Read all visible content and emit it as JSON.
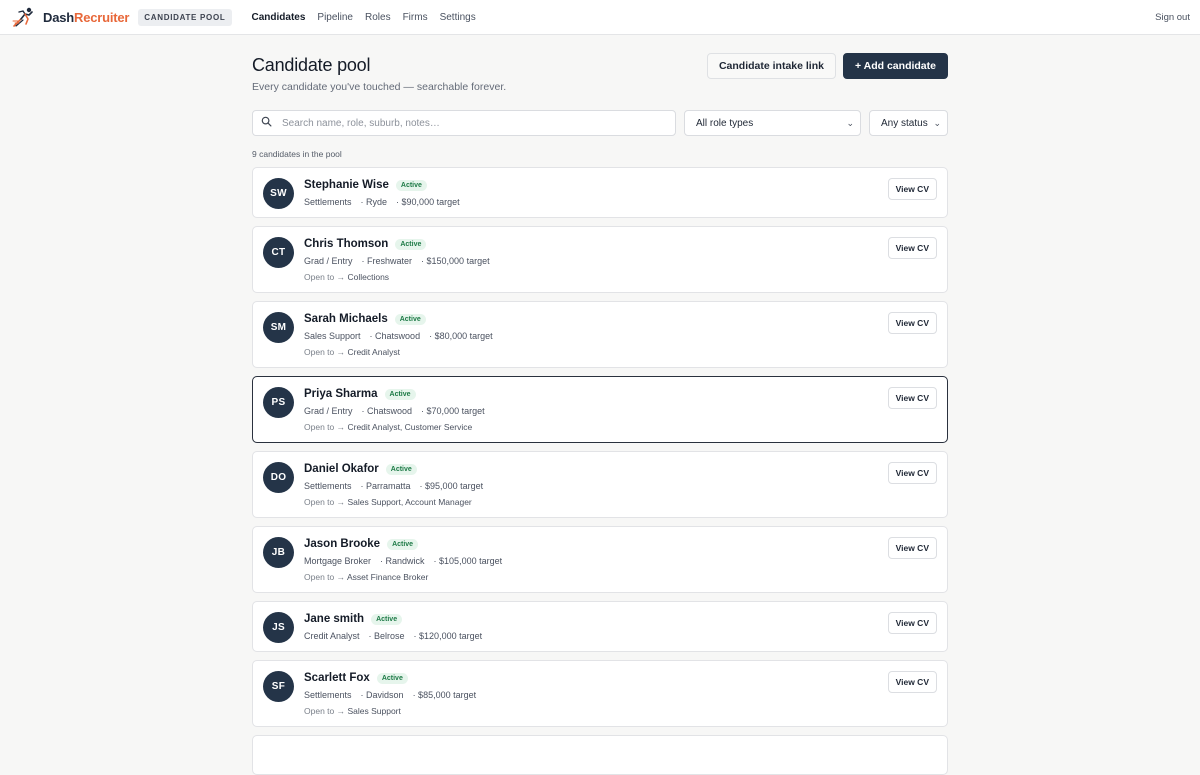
{
  "colors": {
    "brand_dark": "#1f2a3c",
    "brand_accent": "#e8683a",
    "primary_button": "#243448",
    "avatar_bg": "#243448",
    "status_active_bg": "#e6f5ec",
    "status_active_text": "#1d7a46"
  },
  "header": {
    "brand_part1": "Dash",
    "brand_part2": "Recruiter",
    "section_tag": "CANDIDATE POOL",
    "nav": [
      "Candidates",
      "Pipeline",
      "Roles",
      "Firms",
      "Settings"
    ],
    "active_nav": "Candidates",
    "signout": "Sign out",
    "logo_icon": "running-figure-logo-icon"
  },
  "page": {
    "title": "Candidate pool",
    "subtitle": "Every candidate you've touched — searchable forever.",
    "intake_button": "Candidate intake link",
    "add_button": "+ Add candidate"
  },
  "filters": {
    "search_placeholder": "Search name, role, suburb, notes…",
    "search_value": "",
    "search_icon": "search-icon",
    "role_type_selected": "All role types",
    "status_selected": "Any status"
  },
  "count_text": "9 candidates in the pool",
  "candidates": [
    {
      "initials": "SW",
      "name": "Stephanie Wise",
      "status": "Active",
      "role": "Settlements",
      "suburb": "· Ryde",
      "target": "· $90,000 target",
      "open_label": "",
      "open_roles": ""
    },
    {
      "initials": "CT",
      "name": "Chris Thomson",
      "status": "Active",
      "role": "Grad / Entry",
      "suburb": "· Freshwater",
      "target": "· $150,000 target",
      "open_label": "Open to →",
      "open_roles": "Collections"
    },
    {
      "initials": "SM",
      "name": "Sarah Michaels",
      "status": "Active",
      "role": "Sales Support",
      "suburb": "· Chatswood",
      "target": "· $80,000 target",
      "open_label": "Open to →",
      "open_roles": "Credit Analyst"
    },
    {
      "initials": "PS",
      "name": "Priya Sharma",
      "status": "Active",
      "role": "Grad / Entry",
      "suburb": "· Chatswood",
      "target": "· $70,000 target",
      "open_label": "Open to →",
      "open_roles": "Credit Analyst, Customer Service",
      "selected": true
    },
    {
      "initials": "DO",
      "name": "Daniel Okafor",
      "status": "Active",
      "role": "Settlements",
      "suburb": "· Parramatta",
      "target": "· $95,000 target",
      "open_label": "Open to →",
      "open_roles": "Sales Support, Account Manager"
    },
    {
      "initials": "JB",
      "name": "Jason Brooke",
      "status": "Active",
      "role": "Mortgage Broker",
      "suburb": "· Randwick",
      "target": "· $105,000 target",
      "open_label": "Open to →",
      "open_roles": "Asset Finance Broker"
    },
    {
      "initials": "JS",
      "name": "Jane smith",
      "status": "Active",
      "role": "Credit Analyst",
      "suburb": "· Belrose",
      "target": "· $120,000 target",
      "open_label": "",
      "open_roles": ""
    },
    {
      "initials": "SF",
      "name": "Scarlett Fox",
      "status": "Active",
      "role": "Settlements",
      "suburb": "· Davidson",
      "target": "· $85,000 target",
      "open_label": "Open to →",
      "open_roles": "Sales Support"
    }
  ],
  "view_cv_label": "View CV"
}
